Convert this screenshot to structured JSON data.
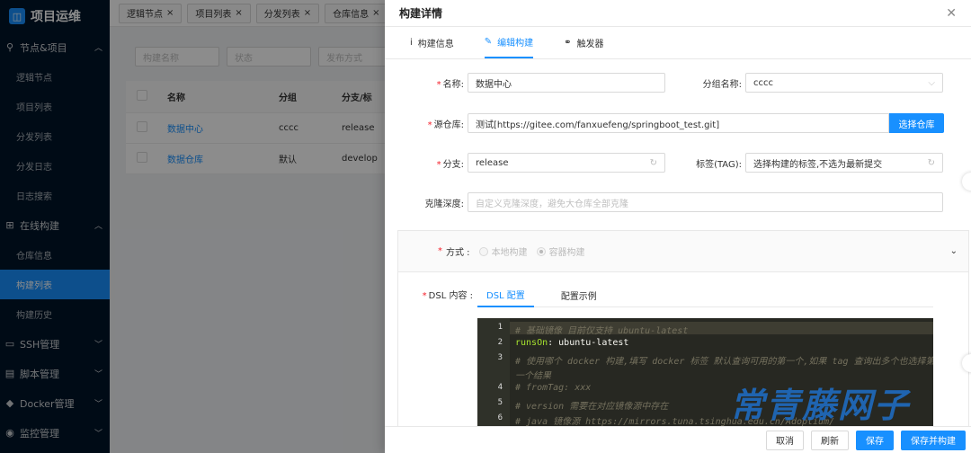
{
  "app": {
    "title": "项目运维"
  },
  "sidebar": {
    "groups": [
      {
        "label": "节点&项目",
        "items": [
          "逻辑节点",
          "项目列表",
          "分发列表",
          "分发日志",
          "日志搜索"
        ]
      },
      {
        "label": "在线构建",
        "items": [
          "仓库信息",
          "构建列表",
          "构建历史"
        ]
      },
      {
        "label": "SSH管理"
      },
      {
        "label": "脚本管理"
      },
      {
        "label": "Docker管理"
      },
      {
        "label": "监控管理"
      }
    ],
    "active": "构建列表"
  },
  "tabs": [
    "逻辑节点",
    "项目列表",
    "分发列表",
    "仓库信息"
  ],
  "filters": {
    "name_ph": "构建名称",
    "status_ph": "状态",
    "method_ph": "发布方式"
  },
  "table": {
    "headers": [
      "名称",
      "分组",
      "分支/标"
    ],
    "rows": [
      {
        "name": "数据中心",
        "group": "cccc",
        "branch": "release"
      },
      {
        "name": "数据仓库",
        "group": "默认",
        "branch": "develop"
      }
    ]
  },
  "drawer": {
    "title": "构建详情",
    "tabs": [
      "构建信息",
      "编辑构建",
      "触发器"
    ],
    "labels": {
      "name": "名称:",
      "group": "分组名称:",
      "repo": "源仓库:",
      "branch": "分支:",
      "tag": "标签(TAG):",
      "depth": "克隆深度:",
      "method": "方式 :",
      "dsl": "DSL 内容 :"
    },
    "values": {
      "name": "数据中心",
      "group": "cccc",
      "repo": "测试[https://gitee.com/fanxuefeng/springboot_test.git]",
      "branch": "release",
      "tag_ph": "选择构建的标签,不选为最新提交",
      "depth_ph": "自定义克隆深度，避免大仓库全部克隆"
    },
    "select_repo_btn": "选择仓库",
    "method_options": [
      "本地构建",
      "容器构建"
    ],
    "dsl_tabs": [
      "DSL 配置",
      "配置示例"
    ],
    "code_lines": [
      {
        "n": "1",
        "text": "# 基础镜像 目前仅支持 ubuntu-latest"
      },
      {
        "n": "2",
        "key": "runsOn",
        "val": ": ubuntu-latest"
      },
      {
        "n": "3",
        "text": "# 使用哪个 docker 构建,填写 docker 标签 默认查询可用的第一个,如果 tag 查询出多个也选择第"
      },
      {
        "n": "",
        "text": "一个结果"
      },
      {
        "n": "4",
        "text": "# fromTag: xxx"
      },
      {
        "n": "5",
        "text": "# version 需要在对应镜像源中存在"
      },
      {
        "n": "6",
        "text": "# java 镜像源 https://mirrors.tuna.tsinghua.edu.cn/Adoptium/"
      }
    ],
    "footer": [
      "取消",
      "刷新",
      "保存",
      "保存并构建"
    ]
  },
  "watermark": "常青藤网子"
}
